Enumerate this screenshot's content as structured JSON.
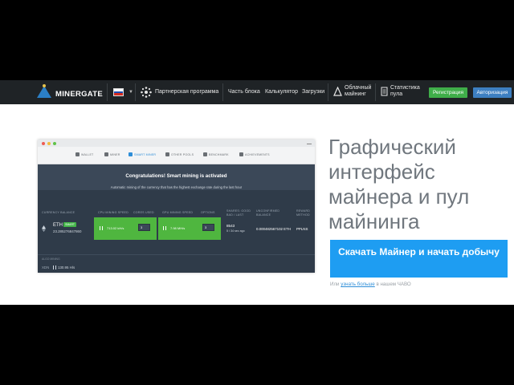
{
  "navbar": {
    "logo_text": "MinerGate",
    "partner_label": "Партнерская программа",
    "links": [
      {
        "label": "Часть блока"
      },
      {
        "label": "Калькулятор"
      },
      {
        "label": "Загрузки"
      }
    ],
    "cloud_label": "Облачный\nмайнинг",
    "stats_label": "Статистика\nпула",
    "register_label": "Регистрация",
    "auth_label": "Авторизация",
    "flag_colors": [
      "#ffffff",
      "#1e4fb4",
      "#d52b1e"
    ]
  },
  "app_window": {
    "tabs": [
      {
        "label": "WALLET",
        "icon": "wallet-icon",
        "active": false
      },
      {
        "label": "MINER",
        "icon": "pickaxe-icon",
        "active": false
      },
      {
        "label": "SMART MINER",
        "icon": "smart-miner-icon",
        "active": true
      },
      {
        "label": "OTHER POOLS",
        "icon": "pools-icon",
        "active": false
      },
      {
        "label": "BENCHMARK",
        "icon": "benchmark-icon",
        "active": false
      },
      {
        "label": "ACHIEVEMENTS",
        "icon": "star-icon",
        "active": false
      }
    ],
    "banner_title": "Congratulations! Smart mining is activated",
    "banner_text": "Automatic mining of the currency that has the highest exchange rate during the last hour",
    "columns": {
      "currency_balance": "CURRENCY BALANCE",
      "cpu_mining_speed": "CPU MINING SPEED",
      "cores_used": "CORES USED",
      "gpu_mining_speed": "GPU MINING SPEED",
      "options": "OPTIONS",
      "shares": "SHARES: GOOD BAD / LAST",
      "unconfirmed_balance": "UNCONFIRMED BALANCE",
      "reward_method": "REWARD METHOD"
    },
    "row": {
      "coin": "ETH",
      "badge": "SMART",
      "balance": "23.285276847860",
      "cpu_speed": "713.02 kH/s",
      "cores": "3",
      "gpu_speed": "7.98 MH/s",
      "options": "3",
      "shares_good": "8543",
      "shares_sub": "5   / 34 sec ago",
      "unconfirmed": "0.000482567102 ETH",
      "reward": "PPLNS"
    },
    "algo_label": "ALGO MINING",
    "cpu_row": {
      "label": "XDN",
      "speed": "130.95 H/s"
    }
  },
  "hero": {
    "headline": "Графический интерфейс майнера и пул майнинга",
    "cta_label": "Скачать Майнер и начать добычу",
    "faq_prefix": "Или ",
    "faq_link": "узнать больше",
    "faq_suffix": " в нашем ЧАВО"
  },
  "colors": {
    "nav_bg": "#1f2326",
    "register": "#3fae49",
    "auth": "#3d7fc1",
    "cta": "#1e9df2",
    "app_green": "#4fb63f",
    "app_bg": "#2f3b49"
  }
}
